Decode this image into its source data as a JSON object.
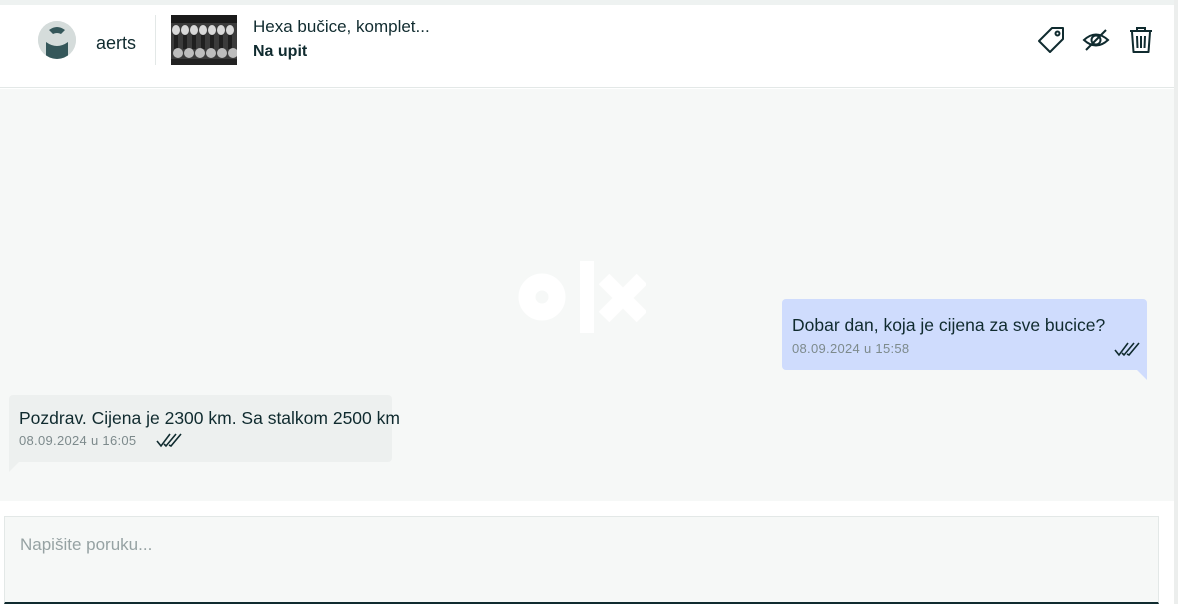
{
  "header": {
    "user": {
      "name": "aerts",
      "avatar_icon": "avatar-placeholder-icon"
    },
    "listing": {
      "title": "Hexa bučice, komplet...",
      "price": "Na upit",
      "thumbnail_icon": "dumbbell-rack-photo"
    },
    "actions": [
      {
        "icon": "price-tag-icon"
      },
      {
        "icon": "eye-off-icon"
      },
      {
        "icon": "trash-icon"
      }
    ]
  },
  "conversation": {
    "watermark_icon": "olx-logo",
    "messages": [
      {
        "direction": "outgoing",
        "text": "Dobar dan, koja je cijena za sve bucice?",
        "time": "08.09.2024 u 15:58",
        "status_icon": "double-check-icon"
      },
      {
        "direction": "incoming",
        "text": "Pozdrav. Cijena je 2300 km. Sa stalkom 2500 km",
        "time": "08.09.2024 u 16:05",
        "status_icon": "double-check-icon"
      }
    ]
  },
  "composer": {
    "placeholder": "Napišite poruku...",
    "value": ""
  },
  "colors": {
    "text": "#102b2f",
    "outgoing_bubble": "#cfdcfd",
    "incoming_bubble": "#edf0ef",
    "chat_background": "#f6f8f7"
  }
}
